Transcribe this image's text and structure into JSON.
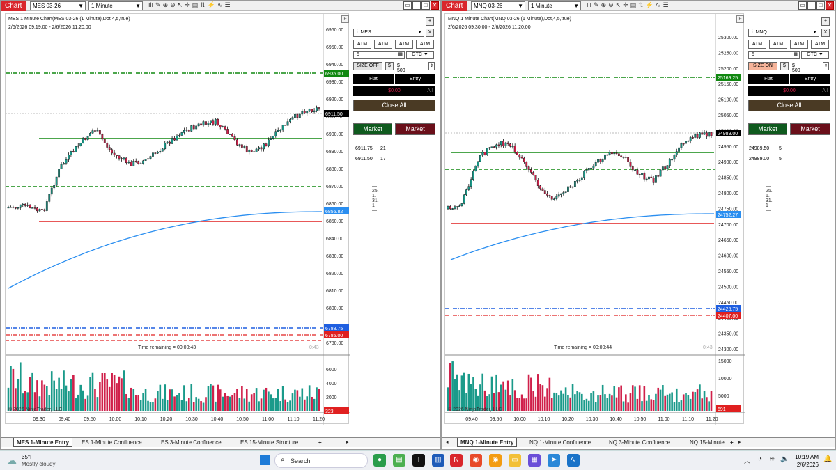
{
  "left": {
    "chart_tab": "Chart",
    "instrument": "MES 03-26",
    "timeframe": "1 Minute",
    "title": "MES 1 Minute Chart(MES 03-26 (1 Minute),Dot,4,5,true)",
    "range": "2/6/2026 09:19:00 - 2/6/2026 11:20:00",
    "price_labels": [
      "6960.00",
      "6950.00",
      "6940.00",
      "6930.00",
      "6920.00",
      "6910.00",
      "6900.00",
      "6890.00",
      "6880.00",
      "6870.00",
      "6860.00",
      "6850.00",
      "6840.00",
      "6830.00",
      "6820.00",
      "6810.00",
      "6800.00",
      "6790.00",
      "6780.00"
    ],
    "tags": {
      "top_green": "6935.00",
      "last": "6911.50",
      "sma": "6855.82",
      "blue": "6788.75",
      "red": "6785.00",
      "vol": "323"
    },
    "volume_labels": [
      "6000",
      "4000",
      "2000"
    ],
    "time_labels": [
      "09:30",
      "09:40",
      "09:50",
      "10:00",
      "10:10",
      "10:20",
      "10:30",
      "10:40",
      "10:50",
      "11:00",
      "11:10",
      "11:20"
    ],
    "time_remaining": "Time remaining = 00:00:43",
    "timer_small": "0:43",
    "copyright": "© 2026 NinjaTrader, LLC",
    "panel": {
      "plus": "+",
      "x": "X",
      "account": "MES",
      "atm": [
        "ATM",
        "ATM",
        "ATM",
        "ATM"
      ],
      "qty": "5",
      "tif": "GTC",
      "size": "SIZE OFF",
      "dollar": "$",
      "amount": "$ 500",
      "flat": "Flat",
      "entry": "Entry",
      "pnl": "$0.00",
      "all": "All",
      "close_all": "Close All",
      "market_buy": "Market",
      "market_sell": "Market",
      "orders": [
        {
          "price": "6911.75",
          "qty": "21"
        },
        {
          "price": "6911.50",
          "qty": "17"
        }
      ],
      "version": "— 25. 1. 31. 1 —"
    },
    "tabs": [
      "MES 1-Minute Entry",
      "ES 1-Minute Confluence",
      "ES 3-Minute Confluence",
      "ES 15-Minute Structure"
    ]
  },
  "right": {
    "chart_tab": "Chart",
    "instrument": "MNQ 03-26",
    "timeframe": "1 Minute",
    "title": "MNQ 1 Minute Chart(MNQ 03-26 (1 Minute),Dot,4,5,true)",
    "range": "2/6/2026 09:30:00 - 2/6/2026 11:20:00",
    "price_labels": [
      "25300.00",
      "25250.00",
      "25200.00",
      "25150.00",
      "25100.00",
      "25050.00",
      "25000.00",
      "24950.00",
      "24900.00",
      "24850.00",
      "24800.00",
      "24750.00",
      "24700.00",
      "24650.00",
      "24600.00",
      "24550.00",
      "24500.00",
      "24450.00",
      "24400.00",
      "24350.00",
      "24300.00"
    ],
    "tags": {
      "top_green": "25169.25",
      "last": "24989.00",
      "sma": "24752.27",
      "blue": "24425.75",
      "red": "24407.00",
      "vol": "691"
    },
    "volume_labels": [
      "15000",
      "10000",
      "5000"
    ],
    "time_labels": [
      "09:40",
      "09:50",
      "10:00",
      "10:10",
      "10:20",
      "10:30",
      "10:40",
      "10:50",
      "11:00",
      "11:10",
      "11:20"
    ],
    "time_remaining": "Time remaining = 00:00:44",
    "timer_small": "0:43",
    "copyright": "© 2026 NinjaTrader, LLC",
    "panel": {
      "plus": "+",
      "x": "X",
      "account": "MNQ",
      "atm": [
        "ATM",
        "ATM",
        "ATM",
        "ATM"
      ],
      "qty": "5",
      "tif": "GTC",
      "size": "SIZE ON",
      "dollar": "$",
      "amount": "$ 500",
      "flat": "Flat",
      "entry": "Entry",
      "pnl": "$0.00",
      "all": "All",
      "close_all": "Close All",
      "market_buy": "Market",
      "market_sell": "Market",
      "orders": [
        {
          "price": "24989.50",
          "qty": "5"
        },
        {
          "price": "24989.00",
          "qty": "5"
        }
      ],
      "version": "— 25. 1. 31. 1 —"
    },
    "tabs": [
      "MNQ 1-Minute Entry",
      "NQ 1-Minute Confluence",
      "NQ 3-Minute Confluence",
      "NQ 15-Minute"
    ]
  },
  "taskbar": {
    "temp": "35°F",
    "weather": "Mostly cloudy",
    "search": "Search",
    "time": "10:19 AM",
    "date": "2/6/2026"
  },
  "colors": {
    "up": "#1a9a8a",
    "down": "#d0204a",
    "green_line": "#118811",
    "red_line": "#e02020",
    "blue_line": "#1f5fe0",
    "sma": "#2a8ef0"
  }
}
